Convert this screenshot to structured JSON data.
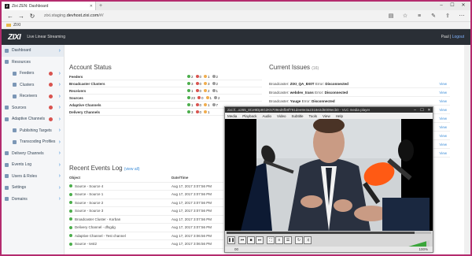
{
  "browser": {
    "tab_title": "Zixi ZEN: Dashboard",
    "url_prefix": "zixi.staging.",
    "url_domain": "devhost.zixi.com",
    "url_suffix": "/#/",
    "favorites_folder": "ZIXI"
  },
  "app": {
    "logo": "ZIXI",
    "tagline": "Live Linear Streaming",
    "user_name": "Paul",
    "user_link": "Logout"
  },
  "sidebar": {
    "items": [
      {
        "label": "Dashboard"
      },
      {
        "label": "Resources"
      },
      {
        "label": "Feeders"
      },
      {
        "label": "Clusters"
      },
      {
        "label": "Receivers"
      },
      {
        "label": "Sources"
      },
      {
        "label": "Adaptive Channels"
      },
      {
        "label": "Publishing Targets"
      },
      {
        "label": "Transcoding Profiles"
      },
      {
        "label": "Delivery Channels"
      },
      {
        "label": "Events Log"
      },
      {
        "label": "Users & Roles"
      },
      {
        "label": "Settings"
      },
      {
        "label": "Domains"
      }
    ]
  },
  "account_status": {
    "title": "Account Status",
    "rows": [
      {
        "label": "Feeders",
        "values": [
          "2",
          "0",
          "1",
          "2"
        ]
      },
      {
        "label": "Broadcaster Clusters",
        "values": [
          "3",
          "0",
          "3",
          "2"
        ]
      },
      {
        "label": "Receivers",
        "values": [
          "1",
          "0",
          "2",
          "1"
        ]
      },
      {
        "label": "Sources",
        "values": [
          "23",
          "0",
          "1",
          "2"
        ]
      },
      {
        "label": "Adaptive Channels",
        "values": [
          "1",
          "0",
          "1",
          "7"
        ]
      },
      {
        "label": "Delivery Channels",
        "values": [
          "3",
          "0",
          "1"
        ]
      }
    ]
  },
  "current_issues": {
    "title": "Current Issues",
    "count": "(16)",
    "view_label": "View",
    "items": [
      {
        "prefix": "Broadcaster:",
        "name": "ZIXI_QA_8X0T",
        "rest": "Error:",
        "status": "Disconnected"
      },
      {
        "prefix": "Broadcaster:",
        "name": "webdev_trans",
        "rest": "Error:",
        "status": "Disconnected"
      },
      {
        "prefix": "Broadcaster:",
        "name": "Yuuge",
        "rest": "Error:",
        "status": "Disconnected"
      }
    ]
  },
  "events": {
    "title": "Recent Events Log",
    "view_all": "(view all)",
    "col_object": "Object",
    "col_time": "Date/Time",
    "rows": [
      {
        "obj": "Source - Source 4",
        "time": "Aug 17, 2017 3:07:56 PM"
      },
      {
        "obj": "Source - Source 1",
        "time": "Aug 17, 2017 3:07:56 PM"
      },
      {
        "obj": "Source - Source 2",
        "time": "Aug 17, 2017 3:07:56 PM"
      },
      {
        "obj": "Source - Source 3",
        "time": "Aug 17, 2017 3:07:56 PM"
      },
      {
        "obj": "Broadcaster Cluster - Korban",
        "time": "Aug 17, 2017 3:07:56 PM"
      },
      {
        "obj": "Delivery Channel - dfsgdg",
        "time": "Aug 17, 2017 3:07:56 PM"
      },
      {
        "obj": "Adaptive Channel - Test channel",
        "time": "Aug 17, 2017 3:06:56 PM"
      },
      {
        "obj": "Source - test2",
        "time": "Aug 17, 2017 3:06:56 PM"
      }
    ]
  },
  "player": {
    "title": "zixi://...x265_8Ce9Dp8G2K5709ed6fb8f781dee8e3a2318e2d5009ecb0 - VLC media player",
    "menu": [
      "Media",
      "Playback",
      "Audio",
      "Video",
      "Subtitle",
      "Tools",
      "View",
      "Help"
    ],
    "status_left": "00",
    "volume_label": "100%"
  }
}
